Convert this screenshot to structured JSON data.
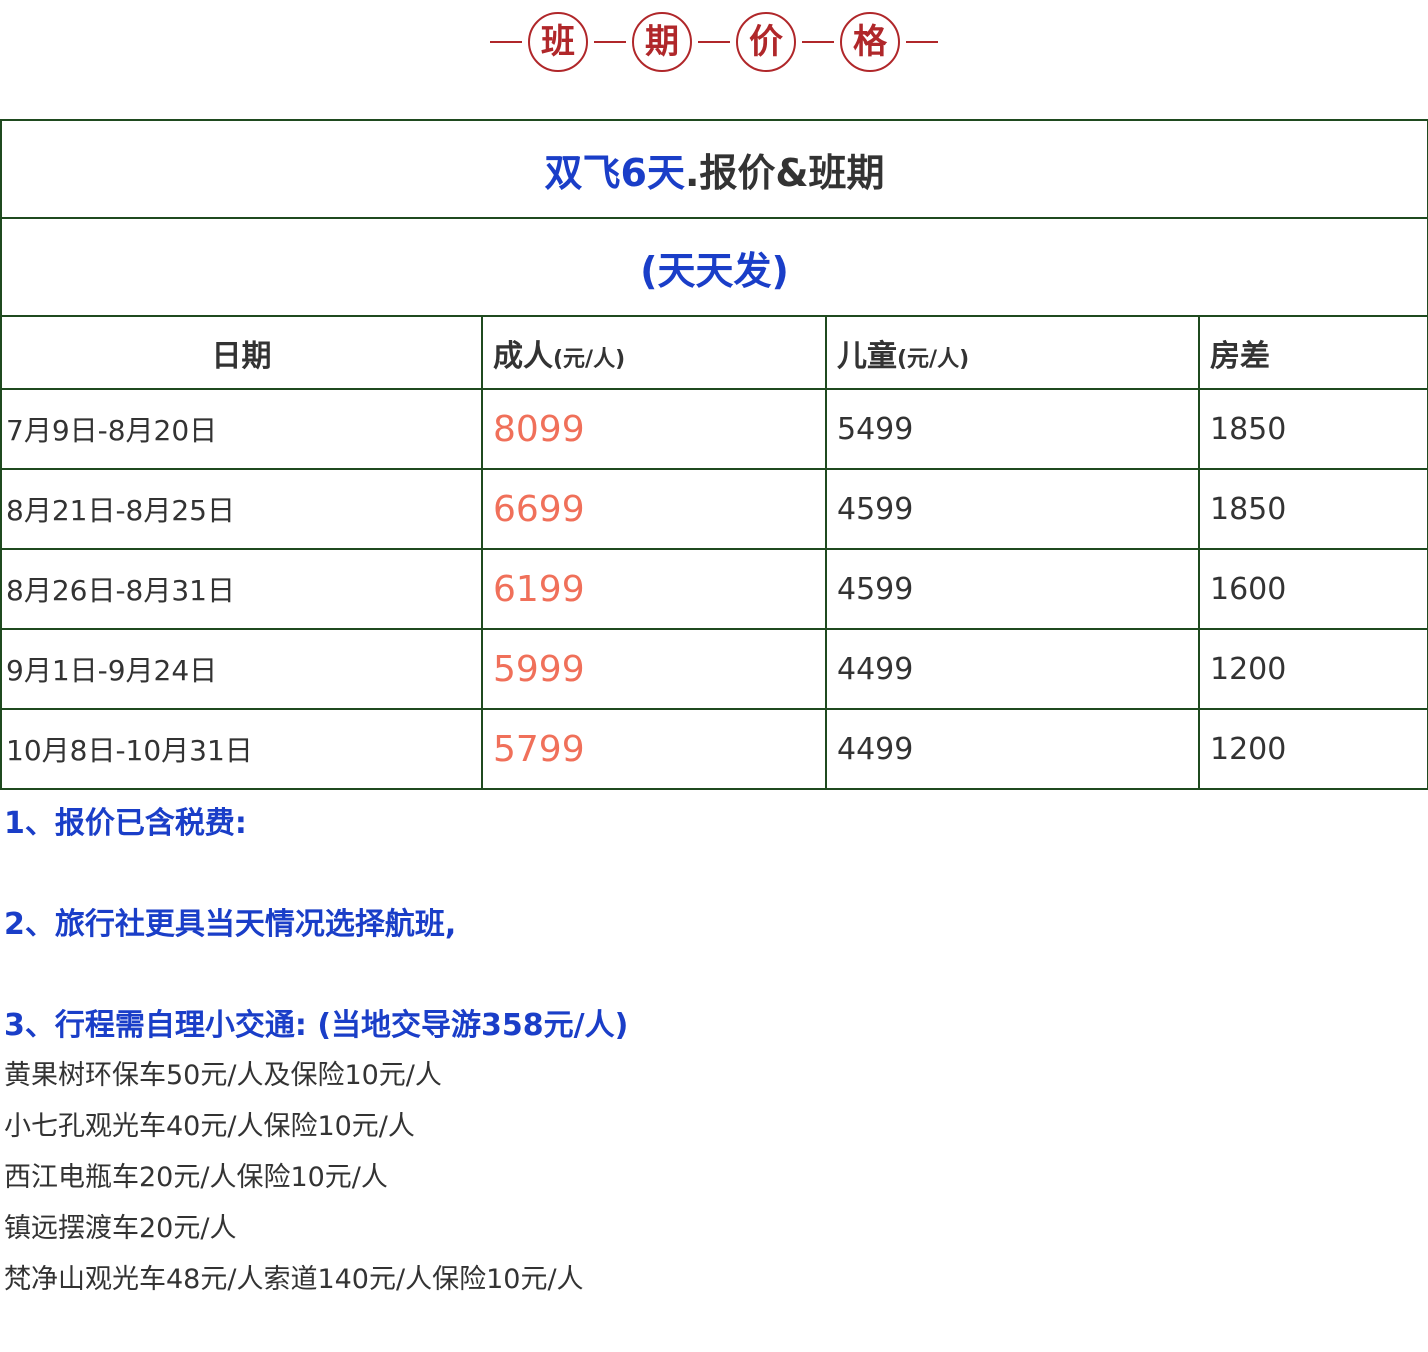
{
  "header": {
    "badges": [
      "班",
      "期",
      "价",
      "格"
    ]
  },
  "table": {
    "title_blue": "双飞6天",
    "title_dark": ".报价&班期",
    "subtitle": "(天天发)",
    "columns": {
      "date": "日期",
      "adult": "成人",
      "adult_unit": "(元/人)",
      "child": "儿童",
      "child_unit": "(元/人)",
      "room": "房差"
    },
    "rows": [
      {
        "date": "7月9日-8月20日",
        "adult": "8099",
        "child": "5499",
        "room": "1850"
      },
      {
        "date": "8月21日-8月25日",
        "adult": "6699",
        "child": "4599",
        "room": "1850"
      },
      {
        "date": "8月26日-8月31日",
        "adult": "6199",
        "child": "4599",
        "room": "1600"
      },
      {
        "date": "9月1日-9月24日",
        "adult": "5999",
        "child": "4499",
        "room": "1200"
      },
      {
        "date": "10月8日-10月31日",
        "adult": "5799",
        "child": "4499",
        "room": "1200"
      }
    ]
  },
  "notes": {
    "items": [
      "1、报价已含税费:",
      "2、旅行社更具当天情况选择航班,",
      "3、行程需自理小交通: (当地交导游358元/人)"
    ],
    "details": [
      "黄果树环保车50元/人及保险10元/人",
      "小七孔观光车40元/人保险10元/人",
      "西江电瓶车20元/人保险10元/人",
      "镇远摆渡车20元/人",
      "梵净山观光车48元/人索道140元/人保险10元/人"
    ]
  },
  "colors": {
    "badge_red": "#b0272a",
    "title_blue": "#1a3ec8",
    "adult_price": "#f0705a",
    "border_green": "#1f4a1f"
  }
}
